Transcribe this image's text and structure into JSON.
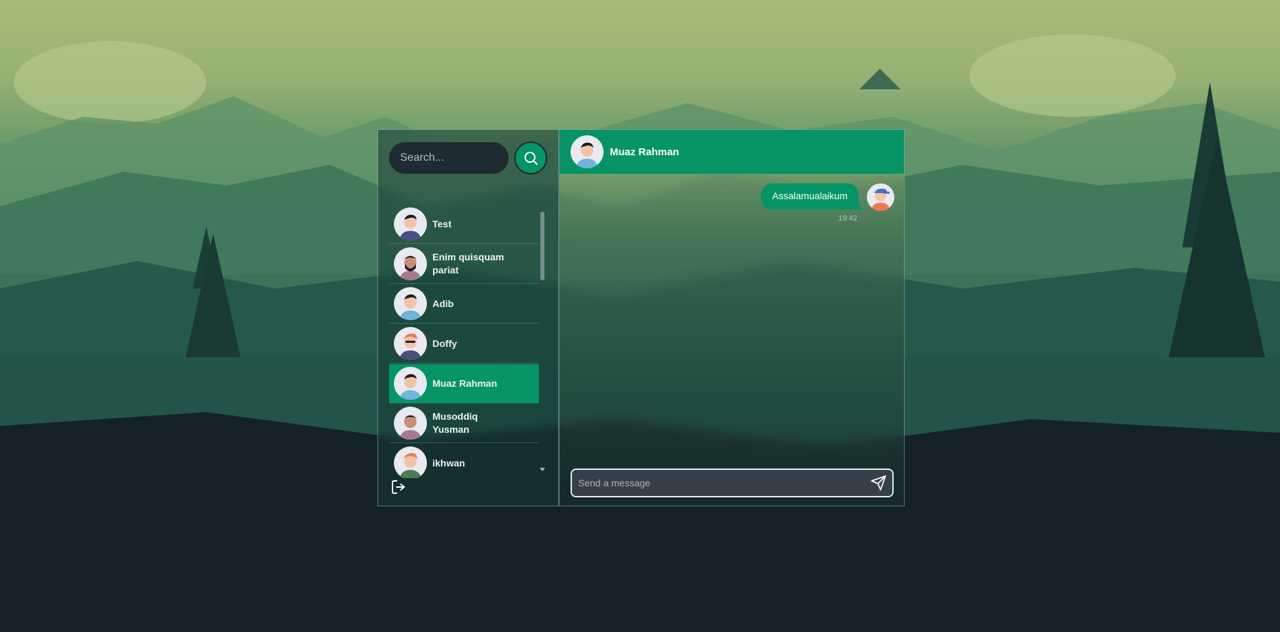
{
  "search": {
    "placeholder": "Search..."
  },
  "contacts": [
    {
      "name": "Test",
      "active": false
    },
    {
      "name": "Enim quisquam pariat",
      "active": false
    },
    {
      "name": "Adib",
      "active": false
    },
    {
      "name": "Doffy",
      "active": false
    },
    {
      "name": "Muaz Rahman",
      "active": true
    },
    {
      "name": "Musoddiq Yusman",
      "active": false
    },
    {
      "name": "ikhwan",
      "active": false
    }
  ],
  "chat": {
    "title": "Muaz Rahman",
    "messages": [
      {
        "text": "Assalamualaikum",
        "time": "19:42"
      }
    ],
    "composer_placeholder": "Send a message"
  },
  "colors": {
    "accent": "#069466",
    "input_bg": "#1f2a33"
  },
  "icons": {
    "search": "search-icon",
    "logout": "logout-icon",
    "send": "send-icon",
    "scroll_down": "chevron-down-icon"
  }
}
